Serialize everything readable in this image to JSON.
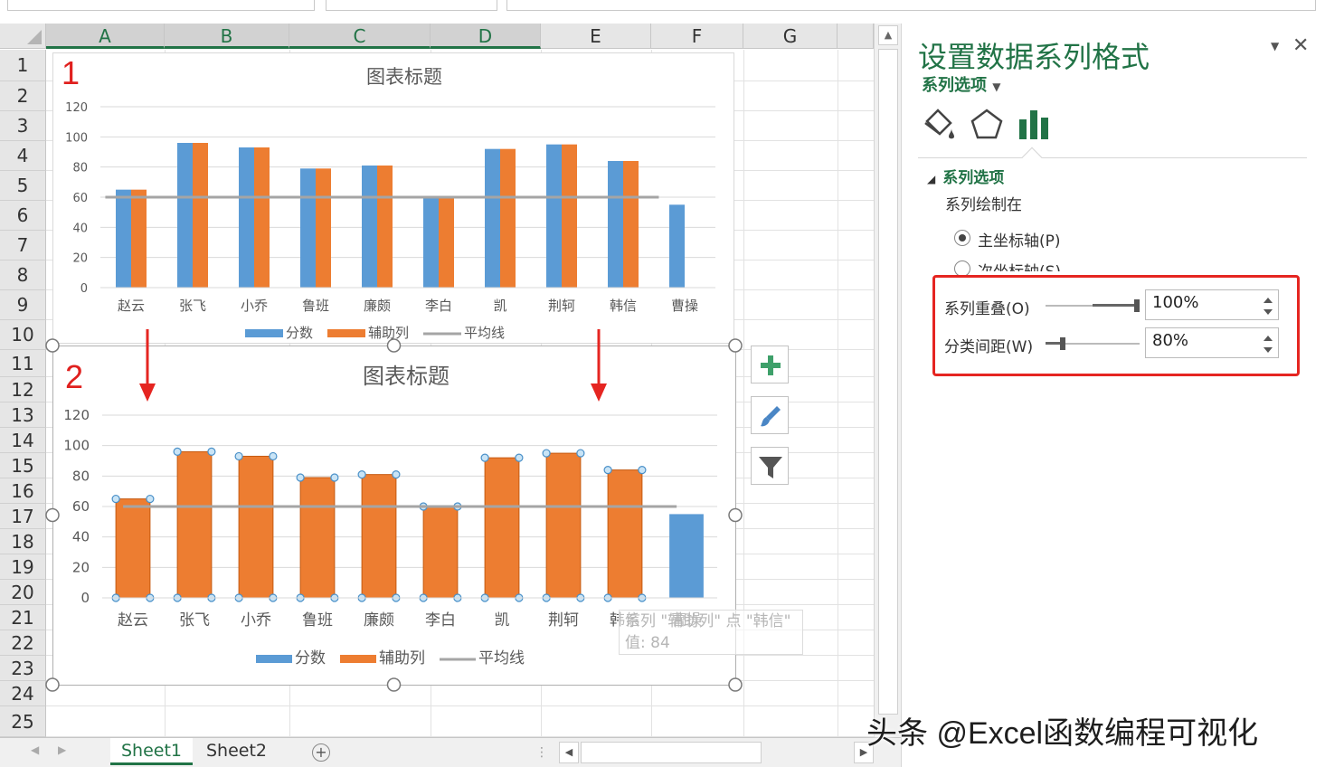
{
  "grid": {
    "columns": [
      "A",
      "B",
      "C",
      "D",
      "E",
      "F",
      "G"
    ],
    "selected_columns": [
      "A",
      "B",
      "C",
      "D"
    ],
    "rows": [
      "1",
      "2",
      "3",
      "4",
      "5",
      "6",
      "7",
      "8",
      "9",
      "10",
      "11",
      "12",
      "13",
      "14",
      "15",
      "16",
      "17",
      "18",
      "19",
      "20",
      "21",
      "22",
      "23",
      "24",
      "25"
    ]
  },
  "sheets": {
    "tabs": [
      "Sheet1",
      "Sheet2"
    ],
    "active": "Sheet1",
    "add_label": "+"
  },
  "chart_data": [
    {
      "type": "bar",
      "marker": "1",
      "title": "图表标题",
      "categories": [
        "赵云",
        "张飞",
        "小乔",
        "鲁班",
        "廉颇",
        "李白",
        "凯",
        "荆轲",
        "韩信",
        "曹操"
      ],
      "series": [
        {
          "name": "分数",
          "type": "bar",
          "color": "#5b9bd5",
          "values": [
            65,
            96,
            93,
            79,
            81,
            60,
            92,
            95,
            84,
            55
          ]
        },
        {
          "name": "辅助列",
          "type": "bar",
          "color": "#ed7d31",
          "values": [
            65,
            96,
            93,
            79,
            81,
            60,
            92,
            95,
            84,
            null
          ]
        },
        {
          "name": "平均线",
          "type": "line",
          "color": "#a5a5a5",
          "values": [
            60,
            60,
            60,
            60,
            60,
            60,
            60,
            60,
            60,
            60
          ]
        }
      ],
      "ylim": [
        0,
        120
      ],
      "yticks": [
        0,
        20,
        40,
        60,
        80,
        100,
        120
      ],
      "grid": true,
      "legend": "bottom",
      "overlap_percent": 0,
      "gap_percent": 200
    },
    {
      "type": "bar",
      "marker": "2",
      "title": "图表标题",
      "categories": [
        "赵云",
        "张飞",
        "小乔",
        "鲁班",
        "廉颇",
        "李白",
        "凯",
        "荆轲",
        "韩信",
        "曹操"
      ],
      "series": [
        {
          "name": "分数",
          "type": "bar",
          "color": "#5b9bd5",
          "values": [
            65,
            96,
            93,
            79,
            81,
            60,
            92,
            95,
            84,
            55
          ]
        },
        {
          "name": "辅助列",
          "type": "bar",
          "color": "#ed7d31",
          "values": [
            65,
            96,
            93,
            79,
            81,
            60,
            92,
            95,
            84,
            null
          ],
          "selected": true
        },
        {
          "name": "平均线",
          "type": "line",
          "color": "#a5a5a5",
          "values": [
            60,
            60,
            60,
            60,
            60,
            60,
            60,
            60,
            60,
            60
          ]
        }
      ],
      "ylim": [
        0,
        120
      ],
      "yticks": [
        0,
        20,
        40,
        60,
        80,
        100,
        120
      ],
      "grid": true,
      "legend": "bottom",
      "overlap_percent": 100,
      "gap_percent": 80
    }
  ],
  "tooltip": {
    "line1": "系列 \"辅助列\" 点 \"韩信\"",
    "line2": "值: 84"
  },
  "chart_tools": [
    "plus-icon",
    "brush-icon",
    "filter-icon"
  ],
  "panel": {
    "title": "设置数据系列格式",
    "subtitle": "系列选项",
    "section": "系列选项",
    "plotted_on": "系列绘制在",
    "primary_axis": "主坐标轴(P)",
    "secondary_axis": "次坐标轴(S)",
    "overlap_label": "系列重叠(O)",
    "overlap_value": "100%",
    "gap_label": "分类间距(W)",
    "gap_value": "80%",
    "close": "✕",
    "icons": [
      "fill-bucket-icon",
      "pentagon-icon",
      "bar-chart-icon"
    ]
  },
  "watermark": "头条 @Excel函数编程可视化"
}
